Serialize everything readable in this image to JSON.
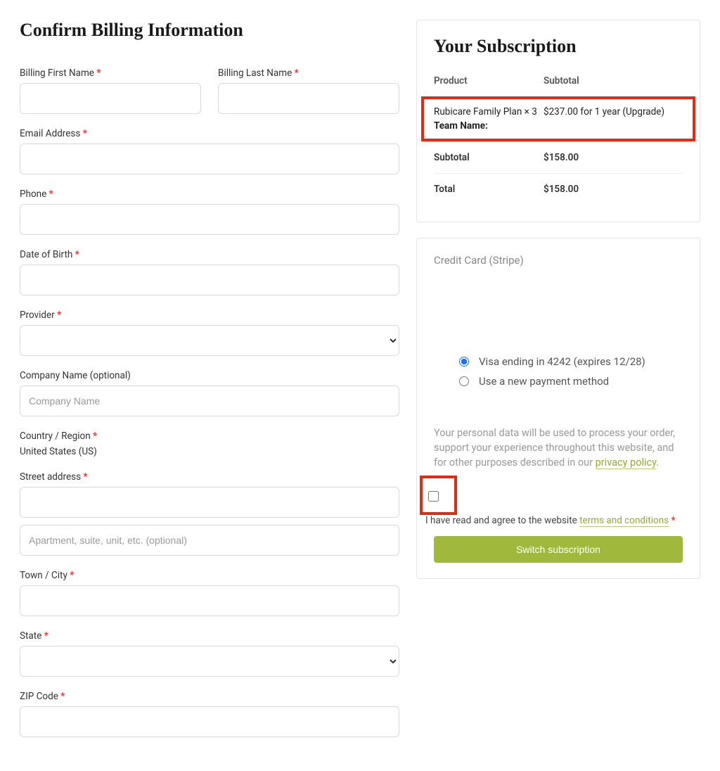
{
  "billing": {
    "title": "Confirm Billing Information",
    "firstName": {
      "label": "Billing First Name",
      "value": ""
    },
    "lastName": {
      "label": "Billing Last Name",
      "value": ""
    },
    "email": {
      "label": "Email Address",
      "value": ""
    },
    "phone": {
      "label": "Phone",
      "value": ""
    },
    "dob": {
      "label": "Date of Birth",
      "value": ""
    },
    "provider": {
      "label": "Provider",
      "value": ""
    },
    "company": {
      "label": "Company Name (optional)",
      "placeholder": "Company Name",
      "value": ""
    },
    "country": {
      "label": "Country / Region",
      "value": "United States (US)"
    },
    "street": {
      "label": "Street address",
      "value": "",
      "line2Placeholder": "Apartment, suite, unit, etc. (optional)",
      "line2Value": ""
    },
    "city": {
      "label": "Town / City",
      "value": ""
    },
    "state": {
      "label": "State",
      "value": ""
    },
    "zip": {
      "label": "ZIP Code",
      "value": ""
    }
  },
  "subscription": {
    "title": "Your Subscription",
    "headers": {
      "product": "Product",
      "subtotal": "Subtotal"
    },
    "productLine": "Rubicare Family Plan × 3",
    "teamNameLabel": "Team Name:",
    "productSubtotal": "$237.00 for 1 year (Upgrade)",
    "subtotalLabel": "Subtotal",
    "subtotalValue": "$158.00",
    "totalLabel": "Total",
    "totalValue": "$158.00"
  },
  "payment": {
    "method": "Credit Card (Stripe)",
    "savedCard": "Visa ending in 4242 (expires 12/28)",
    "newMethod": "Use a new payment method",
    "privacy": {
      "text": "Your personal data will be used to process your order, support your experience throughout this website, and for other purposes described in our ",
      "link": "privacy policy",
      "suffix": "."
    },
    "terms": {
      "text": "I have read and agree to the website ",
      "link": "terms and conditions"
    },
    "button": "Switch subscription"
  },
  "required": "*"
}
